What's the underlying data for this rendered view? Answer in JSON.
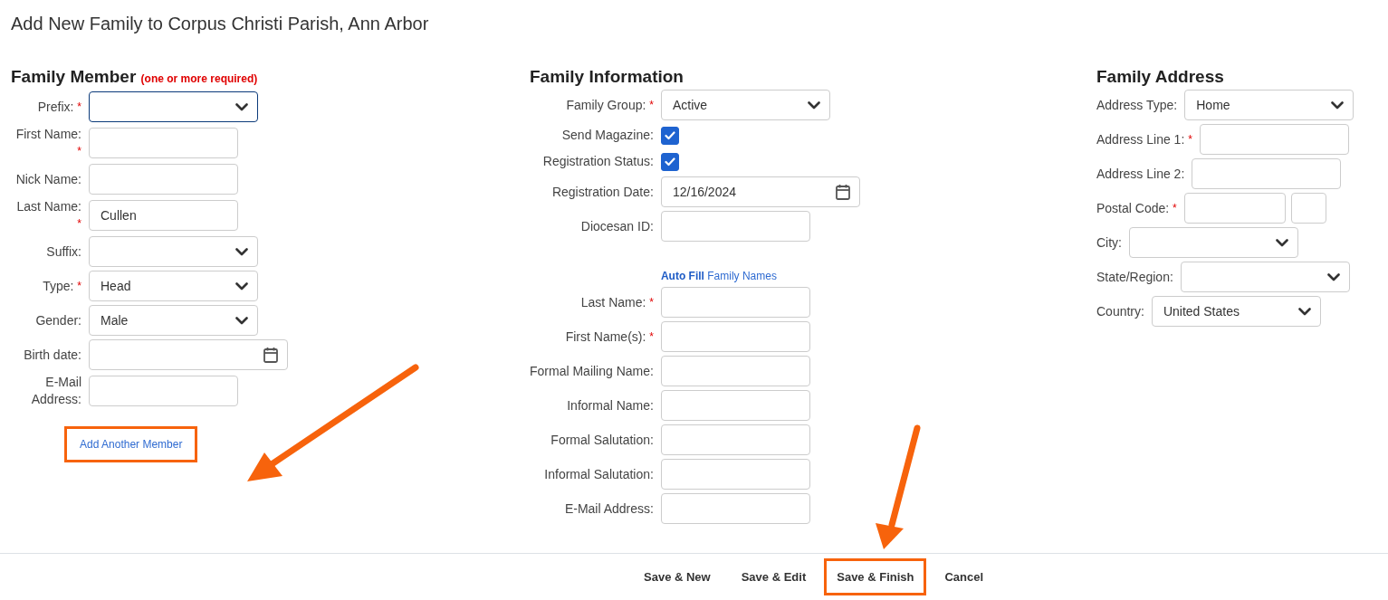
{
  "page_title": "Add New Family to Corpus Christi Parish, Ann Arbor",
  "sections": [
    {
      "kind": "aligned",
      "heading": "Family Member",
      "note": "(one or more required)",
      "fields": [
        {
          "kind": "select",
          "label": "Prefix:",
          "required_mark": "*",
          "focused": true
        },
        {
          "kind": "text",
          "label": "First Name:",
          "required_mark": "*",
          "focused": false
        },
        {
          "kind": "text",
          "label": "Nick Name:",
          "focused": false
        },
        {
          "kind": "text",
          "label": "Last Name:",
          "required_mark": "*",
          "value": "Cullen",
          "focused": false
        },
        {
          "kind": "select",
          "label": "Suffix:",
          "focused": false
        },
        {
          "kind": "select",
          "label": "Type:",
          "required_mark": "*",
          "value": "Head",
          "focused": false
        },
        {
          "kind": "select",
          "label": "Gender:",
          "value": "Male",
          "focused": false
        },
        {
          "kind": "date",
          "label": "Birth date:",
          "focused": false
        },
        {
          "kind": "text",
          "label": "E-Mail Address:",
          "focused": false
        },
        {
          "kind": "link",
          "text": "Add Another Member",
          "highlighted": true
        }
      ]
    },
    {
      "kind": "aligned",
      "heading": "Family Information",
      "fields": [
        {
          "kind": "select",
          "label": "Family Group:",
          "required_mark": "*",
          "value": "Active",
          "focused": false
        },
        {
          "kind": "checkbox",
          "label": "Send Magazine:",
          "checked": true
        },
        {
          "kind": "checkbox",
          "label": "Registration Status:",
          "checked": true
        },
        {
          "kind": "date",
          "label": "Registration Date:",
          "value": "12/16/2024",
          "focused": false
        },
        {
          "kind": "text",
          "label": "Diocesan ID:",
          "focused": false
        },
        {
          "kind": "link",
          "text": "**Auto Fill** Family Names",
          "highlighted": false
        },
        {
          "kind": "text",
          "label": "Last Name:",
          "required_mark": "*",
          "focused": false
        },
        {
          "kind": "text",
          "label": "First Name(s):",
          "required_mark": "*",
          "focused": false
        },
        {
          "kind": "text",
          "label": "Formal Mailing Name:",
          "focused": false
        },
        {
          "kind": "text",
          "label": "Informal Name:",
          "focused": false
        },
        {
          "kind": "text",
          "label": "Formal Salutation:",
          "focused": false
        },
        {
          "kind": "text",
          "label": "Informal Salutation:",
          "focused": false
        },
        {
          "kind": "text",
          "label": "E-Mail Address:",
          "focused": false
        }
      ]
    },
    {
      "kind": "inline",
      "heading": "Family Address",
      "fields": [
        {
          "kind": "select",
          "label": "Address Type:",
          "value": "Home",
          "focused": false
        },
        {
          "kind": "text",
          "label": "Address Line 1:",
          "required_mark": "*",
          "focused": false
        },
        {
          "kind": "text",
          "label": "Address Line 2:",
          "focused": false
        },
        {
          "kind": "postal",
          "label": "Postal Code:",
          "required_mark": "*",
          "focused": false
        },
        {
          "kind": "select",
          "label": "City:",
          "focused": false
        },
        {
          "kind": "select",
          "label": "State/Region:",
          "focused": false
        },
        {
          "kind": "select",
          "label": "Country:",
          "value": "United States",
          "focused": false
        }
      ]
    }
  ],
  "buttons": [
    {
      "label": "Save & New",
      "highlighted": false
    },
    {
      "label": "Save & Edit",
      "highlighted": false
    },
    {
      "label": "Save & Finish",
      "highlighted": true
    },
    {
      "label": "Cancel",
      "highlighted": false
    }
  ]
}
